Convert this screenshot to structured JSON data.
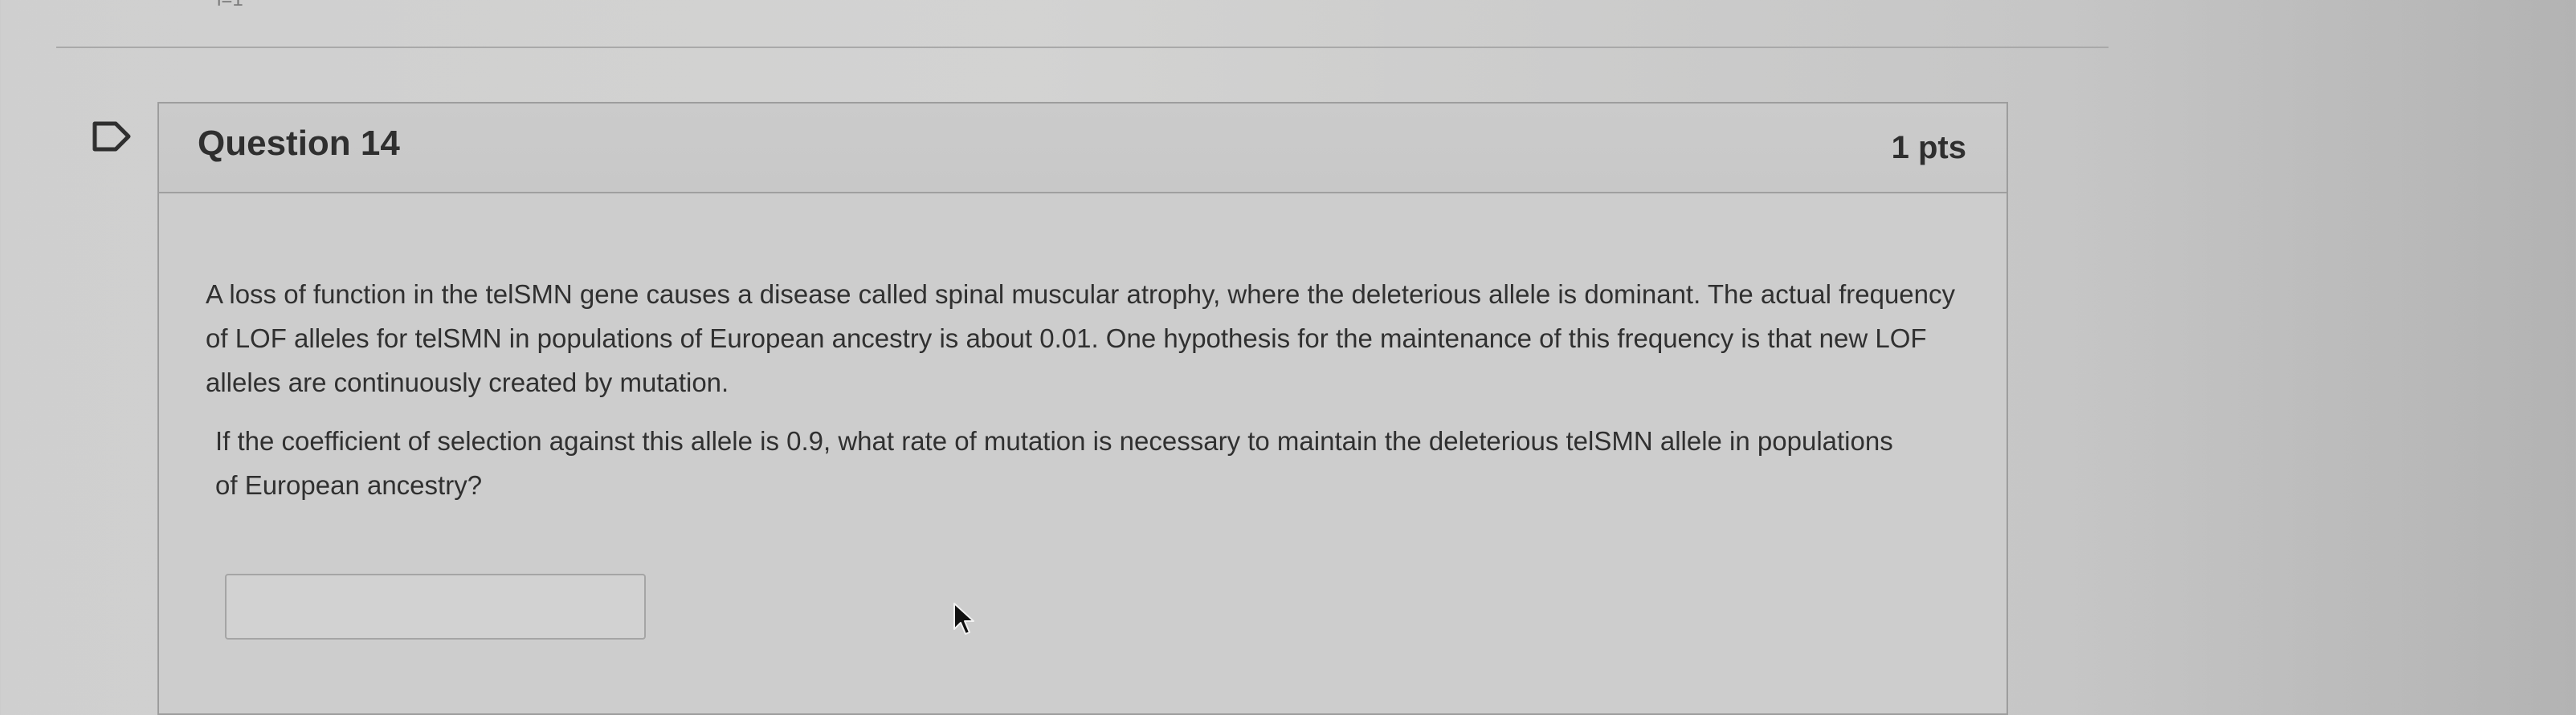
{
  "top_fragment": "i=1",
  "question": {
    "title": "Question 14",
    "points": "1 pts",
    "paragraph1": "A loss of function in the telSMN gene causes a disease called spinal muscular atrophy, where the deleterious allele is dominant. The actual frequency of LOF alleles for telSMN in populations of European ancestry is about 0.01. One hypothesis for the maintenance of this frequency is that new LOF alleles are continuously created by mutation.",
    "paragraph2": "If the coefficient of selection against this allele is 0.9, what rate of mutation is necessary to maintain the deleterious telSMN allele in populations of European ancestry?",
    "answer_value": ""
  },
  "icons": {
    "flag": "flag-outline-icon",
    "cursor": "mouse-pointer-icon"
  },
  "colors": {
    "background": "#d0d0d0",
    "card_border": "#9d9d9d",
    "text": "#303030"
  }
}
